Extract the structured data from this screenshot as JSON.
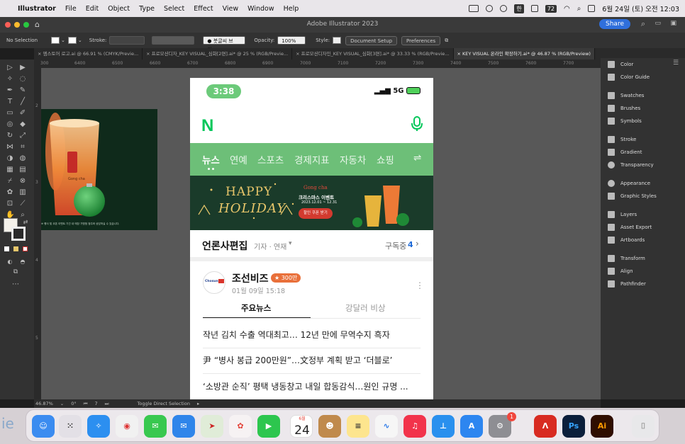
{
  "menubar": {
    "apple": "",
    "app_name": "Illustrator",
    "menus": [
      "File",
      "Edit",
      "Object",
      "Type",
      "Select",
      "Effect",
      "View",
      "Window",
      "Help"
    ],
    "badge1": "한",
    "badge2": "72",
    "datetime": "6월 24일 (토) 오전 12:03"
  },
  "window": {
    "title": "Adobe Illustrator 2023",
    "share_label": "Share"
  },
  "controlbar": {
    "selection": "No Selection",
    "stroke_label": "Stroke:",
    "brush_label": "● 붓글씨 브러...",
    "opacity_label": "Opacity:",
    "opacity_value": "100%",
    "style_label": "Style:",
    "doc_setup": "Document Setup",
    "preferences": "Preferences"
  },
  "tabs": [
    {
      "label": "× 엠스토어 로고.ai @ 66.91 % (CMYK/Previe..."
    },
    {
      "label": "× 프로모션디자_KEY VISUAL_심화[2편].ai* @ 25 % (RGB/Previe..."
    },
    {
      "label": "× 프로모션디자인_KEY VISUAL_심화[3편].ai* @ 33.33 % (RGB/Previe..."
    },
    {
      "label": "× KEY VISUAL 온라인 확장하기.ai* @ 46.87 % (RGB/Preview)"
    }
  ],
  "ruler_ticks": [
    "300",
    "6400",
    "6500",
    "6600",
    "6700",
    "6800",
    "6900",
    "7000",
    "7100",
    "7200",
    "7300",
    "7400",
    "7500",
    "7600",
    "7700"
  ],
  "vruler_ticks": [
    "2",
    "3",
    "4",
    "5"
  ],
  "panels": [
    "Color",
    "Color Guide",
    "Swatches",
    "Brushes",
    "Symbols",
    "Stroke",
    "Gradient",
    "Transparency",
    "Appearance",
    "Graphic Styles",
    "Layers",
    "Asset Export",
    "Artboards",
    "Transform",
    "Align",
    "Pathfinder"
  ],
  "statusbar": {
    "zoom": "46.87%",
    "rotate": "0°",
    "artboard": "7",
    "tool": "Toggle Direct Selection"
  },
  "artwork": {
    "brand": "Gong cha",
    "caption": "※ 행사 및 쿠폰 이벤트 기간 내 매장 가맹점 점주와 상담하실 수 있습니다."
  },
  "phone": {
    "time": "3:38",
    "network": "5G",
    "logo": "N",
    "nav": [
      "뉴스",
      "연예",
      "스포츠",
      "경제지표",
      "자동차",
      "쇼핑"
    ],
    "nav_icon": "⇌",
    "banner": {
      "brand": "Gong cha",
      "line1": "HAPPY",
      "line2": "HOLIDAY",
      "event": "크리스마스 이벤트",
      "dates": "2023.12.01 ~ 12.31",
      "cta": "할인 쿠폰 받기"
    },
    "edit": {
      "title": "언론사편집",
      "sub": "기자 · 연재",
      "subscribe": "구독중",
      "count": "4"
    },
    "card": {
      "outlet": "조선비즈",
      "badge": "★ 300만",
      "time": "01월 09일 15:18",
      "tabs": [
        "주요뉴스",
        "강달러 비상"
      ],
      "headlines": [
        "작년 김치 수출 역대최고… 12년 만에 무역수지 흑자",
        "尹 “병사 봉급 200만원”…文정부 계획 받고 ‘더블로’",
        "‘소방관 순직’ 평택 냉동창고 내일 합동감식…원인 규명 ..."
      ]
    }
  },
  "dock": {
    "calendar_month": "6월",
    "calendar_day": "24",
    "settings_badge": "1",
    "ps": "Ps",
    "ai": "Ai",
    "partial_text": "ie"
  }
}
